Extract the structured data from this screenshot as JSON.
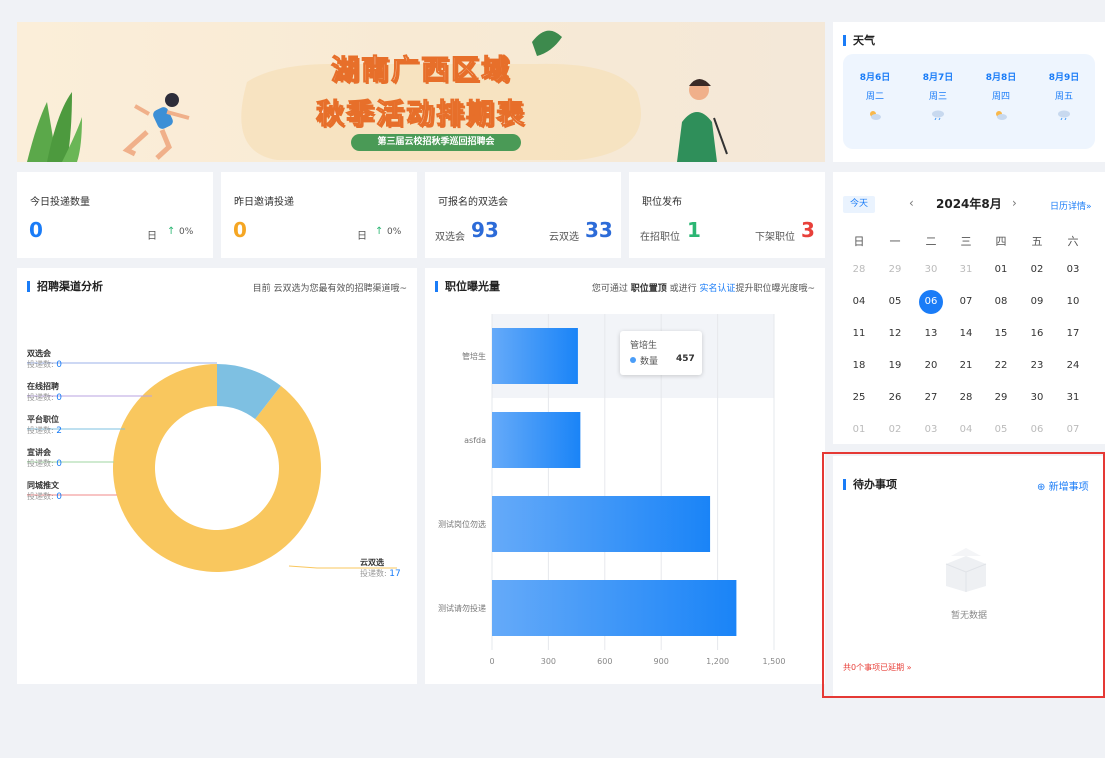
{
  "banner": {
    "title_line1": "湖南广西区域",
    "title_line2": "秋季活动排期表",
    "subtitle": "第三届云校招秋季巡回招聘会"
  },
  "stats": {
    "today": {
      "label": "今日投递数量",
      "value": "0",
      "unit": "日",
      "pct": "0%"
    },
    "yesterday": {
      "label": "昨日邀请投递",
      "value": "0",
      "unit": "日",
      "pct": "0%"
    },
    "fairs": {
      "label": "可报名的双选会",
      "left_label": "双选会",
      "left_value": "93",
      "right_label": "云双选",
      "right_value": "33"
    },
    "jobs": {
      "label": "职位发布",
      "left_label": "在招职位",
      "left_value": "1",
      "right_label": "下架职位",
      "right_value": "3"
    }
  },
  "channel": {
    "title": "招聘渠道分析",
    "hint": "目前 云双选为您最有效的招聘渠道哦~",
    "count_label": "投递数:",
    "items": [
      {
        "name": "双选会",
        "value": "0"
      },
      {
        "name": "在线招聘",
        "value": "0"
      },
      {
        "name": "平台职位",
        "value": "2"
      },
      {
        "name": "宣讲会",
        "value": "0"
      },
      {
        "name": "同城推文",
        "value": "0"
      }
    ],
    "main_item": {
      "name": "云双选",
      "value": "17"
    }
  },
  "exposure": {
    "title": "职位曝光量",
    "hint_a": "您可通过 ",
    "hint_b": "职位置顶",
    "hint_c": " 或进行 ",
    "hint_d": "实名认证",
    "hint_e": "提升职位曝光度哦~",
    "tooltip": {
      "title": "管培生",
      "label": "数量",
      "value": "457"
    }
  },
  "chart_data": [
    {
      "type": "pie",
      "categories": [
        "云双选",
        "平台职位",
        "双选会",
        "在线招聘",
        "宣讲会",
        "同城推文"
      ],
      "values": [
        17,
        2,
        0,
        0,
        0,
        0
      ],
      "colors": [
        "#f9c75e",
        "#7ec0e2",
        "#9bb2e8",
        "#b9a3e0",
        "#9fd6a0",
        "#f08a8a"
      ]
    },
    {
      "type": "bar",
      "orientation": "horizontal",
      "categories": [
        "管培生",
        "asfda",
        "测试岗位勿选",
        "测试请勿投递"
      ],
      "values": [
        457,
        470,
        1160,
        1300
      ],
      "xlim": [
        0,
        1500
      ],
      "xticks": [
        "0",
        "300",
        "600",
        "900",
        "1,200",
        "1,500"
      ]
    }
  ],
  "weather": {
    "title": "天气",
    "days": [
      {
        "date": "8月6日",
        "weekday": "周二"
      },
      {
        "date": "8月7日",
        "weekday": "周三"
      },
      {
        "date": "8月8日",
        "weekday": "周四"
      },
      {
        "date": "8月9日",
        "weekday": "周五"
      }
    ]
  },
  "calendar": {
    "today_label": "今天",
    "month": "2024年8月",
    "detail": "日历详情»",
    "weekdays": [
      "日",
      "一",
      "二",
      "三",
      "四",
      "五",
      "六"
    ],
    "rows": [
      [
        "28",
        "29",
        "30",
        "31",
        "01",
        "02",
        "03"
      ],
      [
        "04",
        "05",
        "06",
        "07",
        "08",
        "09",
        "10"
      ],
      [
        "11",
        "12",
        "13",
        "14",
        "15",
        "16",
        "17"
      ],
      [
        "18",
        "19",
        "20",
        "21",
        "22",
        "23",
        "24"
      ],
      [
        "25",
        "26",
        "27",
        "28",
        "29",
        "30",
        "31"
      ],
      [
        "01",
        "02",
        "03",
        "04",
        "05",
        "06",
        "07"
      ]
    ],
    "selected": "06"
  },
  "todo": {
    "title": "待办事项",
    "add": "新增事项",
    "empty": "暂无数据",
    "overdue": "共0个事项已延期 »"
  }
}
